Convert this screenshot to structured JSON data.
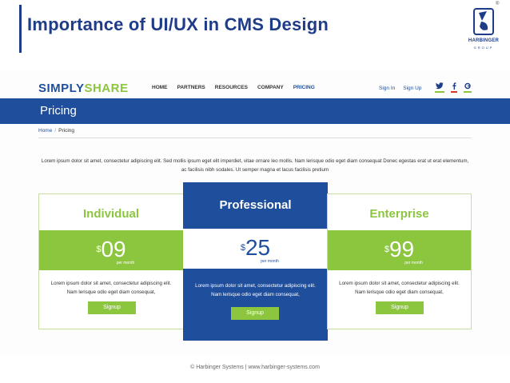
{
  "slide": {
    "title": "Importance of UI/UX in CMS Design",
    "logo_name": "HARBINGER",
    "logo_sub": "GROUP",
    "logo_reg": "®",
    "footer": "© Harbinger Systems | www.harbinger-systems.com"
  },
  "site": {
    "brand_part1": "SIMPLY",
    "brand_part2": "SHARE",
    "nav": [
      "HOME",
      "PARTNERS",
      "RESOURCES",
      "COMPANY",
      "PRICING"
    ],
    "sign_in": "Sign In",
    "sign_up": "Sign Up",
    "social": [
      "twitter-icon",
      "facebook-icon",
      "google-plus-icon"
    ],
    "page_title": "Pricing",
    "breadcrumb_home": "Home",
    "breadcrumb_sep": "/",
    "breadcrumb_current": "Pricing",
    "intro": "Lorem ipsum dolor sit amet, consectetur adipiscing elit. Sed mollis ipsum eget elit imperdiet, vitae ornare leo mollis. Nam lerisque odio eget diam consequat Donec egestas erat ut erat elementum, ac facilisis nibh sodales. Ut semper magna et lacus facilisis pretium"
  },
  "plans": [
    {
      "name": "Individual",
      "currency": "$",
      "price": "09",
      "per": "per month",
      "desc": "Lorem ipsum dolor sit amet, consectetur adipiscing elit. Nam lerisque odio eget diam consequat,",
      "cta": "Signup"
    },
    {
      "name": "Professional",
      "currency": "$",
      "price": "25",
      "per": "per month",
      "desc": "Lorem ipsum dolor sit amet, consectetur adipiscing elit. Nam lerisque odio eget diam consequat,",
      "cta": "Signup"
    },
    {
      "name": "Enterprise",
      "currency": "$",
      "price": "99",
      "per": "per month",
      "desc": "Lorem ipsum dolor sit amet, consectetur adipiscing elit. Nam lerisque odio eget diam consequat,",
      "cta": "Signup"
    }
  ],
  "colors": {
    "primary_blue": "#1f4e9c",
    "accent_green": "#8cc63f",
    "title_blue": "#1f3c88"
  }
}
